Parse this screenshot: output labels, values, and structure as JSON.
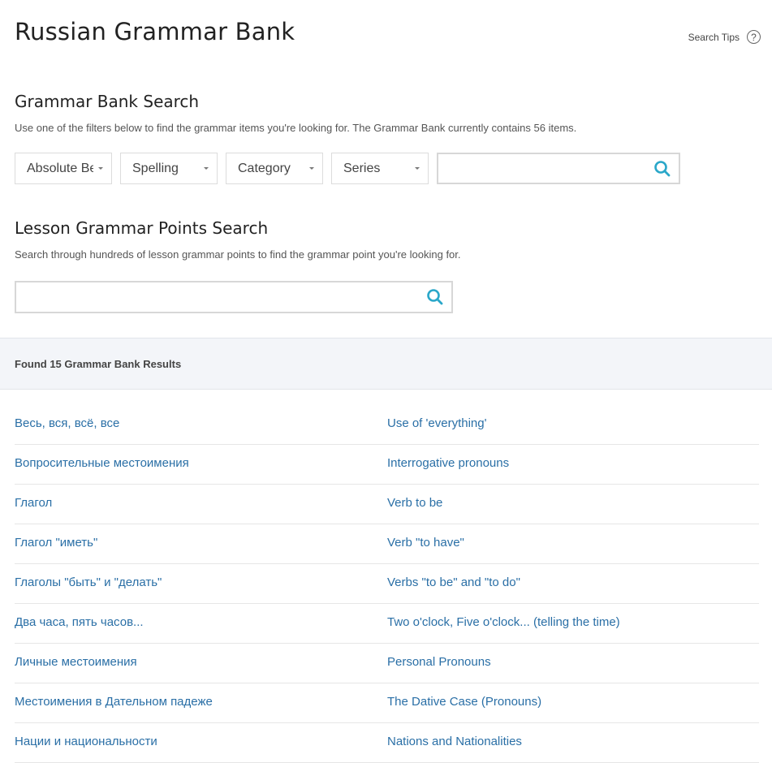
{
  "header": {
    "title": "Russian Grammar Bank",
    "search_tips": "Search Tips",
    "help_glyph": "?"
  },
  "grammar_bank": {
    "heading": "Grammar Bank Search",
    "description": "Use one of the filters below to find the grammar items you're looking for. The Grammar Bank currently contains 56 items.",
    "filters": [
      "Absolute Be",
      "Spelling",
      "Category",
      "Series"
    ],
    "search_value": "",
    "search_placeholder": ""
  },
  "lesson_points": {
    "heading": "Lesson Grammar Points Search",
    "description": "Search through hundreds of lesson grammar points to find the grammar point you're looking for.",
    "search_value": "",
    "search_placeholder": ""
  },
  "results": {
    "count_label": "Found 15 Grammar Bank Results",
    "items": [
      {
        "ru": "Весь, вся, всё, все",
        "en": "Use of 'everything'"
      },
      {
        "ru": "Вопросительные местоимения",
        "en": "Interrogative pronouns"
      },
      {
        "ru": "Глагол",
        "en": "Verb to be"
      },
      {
        "ru": "Глагол \"иметь\"",
        "en": "Verb \"to have\""
      },
      {
        "ru": "Глаголы \"быть\" и \"делать\"",
        "en": "Verbs \"to be\" and \"to do\""
      },
      {
        "ru": "Два часа, пять часов...",
        "en": "Two o'clock, Five o'clock... (telling the time)"
      },
      {
        "ru": "Личные местоимения",
        "en": "Personal Pronouns"
      },
      {
        "ru": "Местоимения в Дательном падеже",
        "en": "The Dative Case (Pronouns)"
      },
      {
        "ru": "Нации и национальности",
        "en": "Nations and Nationalities"
      }
    ]
  },
  "colors": {
    "link": "#2a6fa6",
    "search_icon": "#2aa7c9",
    "results_bar_bg": "#f3f5f9"
  },
  "icons": {
    "search": "search-icon",
    "help": "help-circle-icon",
    "dropdown": "chevron-down-icon"
  }
}
